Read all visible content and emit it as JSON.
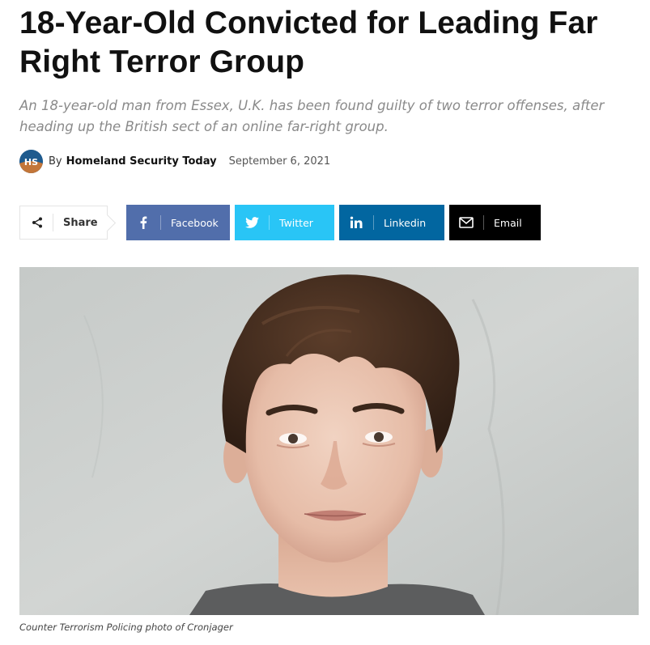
{
  "article": {
    "title": "18-Year-Old Convicted for Leading Far Right Terror Group",
    "subtitle": "An 18-year-old man from Essex, U.K. has been found guilty of two terror offenses, after heading up the British sect of an online far-right group.",
    "byline_prefix": "By",
    "author": "Homeland Security Today",
    "author_avatar_text": "HS",
    "date": "September 6, 2021"
  },
  "share": {
    "label": "Share",
    "icon": "share-icon",
    "buttons": [
      {
        "label": "Facebook",
        "icon": "facebook-icon",
        "color": "#516eab"
      },
      {
        "label": "Twitter",
        "icon": "twitter-icon",
        "color": "#29c5f6"
      },
      {
        "label": "Linkedin",
        "icon": "linkedin-icon",
        "color": "#0266a0"
      },
      {
        "label": "Email",
        "icon": "email-icon",
        "color": "#000000"
      }
    ]
  },
  "photo": {
    "caption": "Counter Terrorism Policing photo of Cronjager"
  }
}
